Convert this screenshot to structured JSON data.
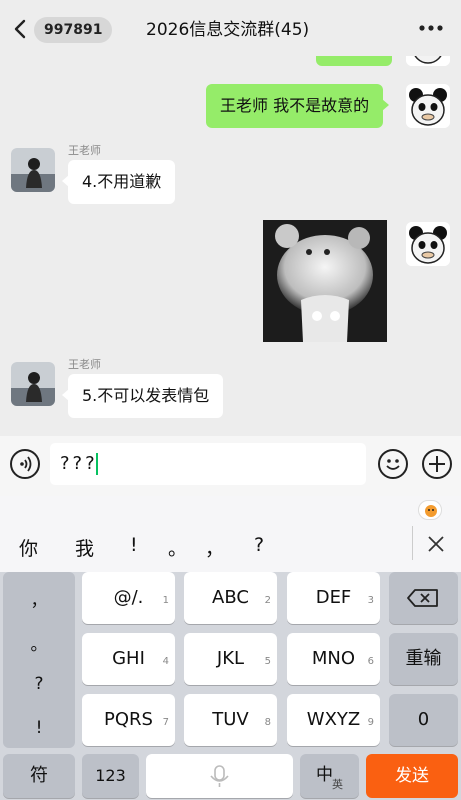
{
  "header": {
    "badge_count": "997891",
    "title": "2026信息交流群(45)"
  },
  "chat": {
    "messages": [
      {
        "from": "self",
        "text": "王老师 我不是故意的"
      },
      {
        "from": "teacher",
        "sender_name": "王老师",
        "text": "4.不用道歉"
      },
      {
        "from": "self",
        "type": "sticker"
      },
      {
        "from": "teacher",
        "sender_name": "王老师",
        "text": "5.不可以发表情包"
      }
    ]
  },
  "input": {
    "value": "???"
  },
  "candidates": [
    "你",
    "我",
    "!",
    "。",
    "，",
    "?"
  ],
  "keyboard": {
    "punctuation": [
      "，",
      "。",
      "?",
      "!"
    ],
    "rows": [
      [
        {
          "label": "@/.",
          "num": "1"
        },
        {
          "label": "ABC",
          "num": "2"
        },
        {
          "label": "DEF",
          "num": "3"
        }
      ],
      [
        {
          "label": "GHI",
          "num": "4"
        },
        {
          "label": "JKL",
          "num": "5"
        },
        {
          "label": "MNO",
          "num": "6"
        }
      ],
      [
        {
          "label": "PQRS",
          "num": "7"
        },
        {
          "label": "TUV",
          "num": "8"
        },
        {
          "label": "WXYZ",
          "num": "9"
        }
      ]
    ],
    "retype_label": "重输",
    "zero_label": "0",
    "symbol_label": "符",
    "numbers_label": "123",
    "lang_label": "中",
    "lang_sub": "英",
    "send_label": "发送"
  },
  "colors": {
    "accent": "#07c160",
    "bubble_self": "#95ec69",
    "send": "#fa6011"
  }
}
